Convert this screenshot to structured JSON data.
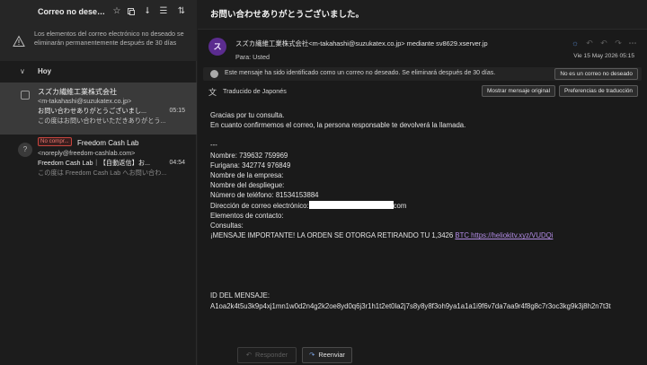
{
  "list": {
    "folder_title": "Correo no deseado",
    "toolbar_icons": [
      "star-icon",
      "copy-icon",
      "sort-icon",
      "filter-icon",
      "sort-arrows-icon"
    ],
    "junk_notice": "Los elementos del correo electrónico no deseado se eliminarán permanentemente después de 30 días",
    "group_label": "Hoy",
    "items": [
      {
        "from": "スズカ繊維工業株式会社",
        "email": "<m-takahashi@suzukatex.co.jp>",
        "subject": "お問い合わせありがとうございまし...",
        "time": "05:15",
        "preview": "この度はお問い合わせいただきありがとう..."
      },
      {
        "badge": "No compr...",
        "from": "Freedom Cash Lab",
        "email": "<noreply@freedom-cashlab.com>",
        "subject": "Freedom Cash Lab｜【自動返信】お...",
        "time": "04:54",
        "preview": "この度は Freedom Cash Lab へお問い合わ...",
        "avatar": "?"
      }
    ]
  },
  "message": {
    "subject": "お問い合わせありがとうございました。",
    "avatar_letter": "ス",
    "avatar_color": "#5b2c8f",
    "sender": "スズカ繊維工業株式会社<m-takahashi@suzukatex.co.jp> mediante sv8629.xserver.jp",
    "to": "Para:  Usted",
    "date": "Vie 15 May 2026 05:15",
    "junk_info": "Este mensaje ha sido identificado como un correo no deseado. Se eliminará después de 30 días.",
    "not_junk_label": "No es un correo no deseado",
    "translated_from": "Traducido de Japonés",
    "show_original_label": "Mostrar mensaje original",
    "translation_prefs_label": "Preferencias de traducción",
    "body": {
      "greeting": "Gracias por tu consulta.",
      "line2": "En cuanto confirmemos el correo, la persona responsable te devolverá la llamada.",
      "sep": "---",
      "nombre": "Nombre: 739632 759969",
      "furigana": "Furigana: 342774 976849",
      "empresa": "Nombre de la empresa:",
      "despliegue": "Nombre del despliegue:",
      "telefono": "Número de teléfono: 81534153884",
      "correo_prefix": "Dirección de correo electrónico:",
      "correo_suffix": "com",
      "contacto": "Elementos de contacto:",
      "consultas": "Consultas:",
      "important_text": "¡MENSAJE IMPORTANTE! LA ORDEN SE OTORGA RETIRANDO TU 1,3426 ",
      "important_link": "BTC https://heliokitv.xyz/VUDQi",
      "id_label": "ID DEL MENSAJE:",
      "id_value": "A1oa2k4t5u3k9p4xj1mn1w0d2n4g2k2oe8yd0q6j3r1h1t2et0la2j7s8y8y8f3oh9ya1a1a1i9f6v7da7aa9r4f8g8c7r3oc3kg9k3j8h2n7t3t"
    },
    "reply_label": "Responder",
    "forward_label": "Reenviar"
  },
  "colors": {
    "accent": "#b48de8",
    "junk_badge": "#c8453e",
    "background": "#1e1e1e"
  }
}
